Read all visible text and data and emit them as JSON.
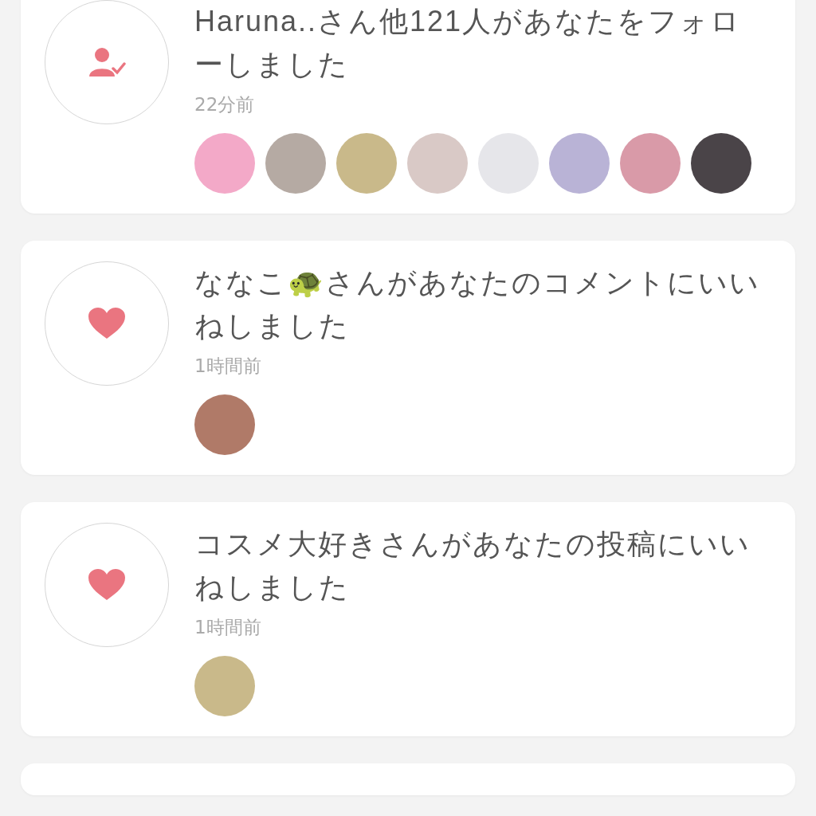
{
  "notifications": [
    {
      "kind": "follow",
      "text": "Haruna..さん他121人があなたをフォローしました",
      "time": "22分前",
      "avatars": [
        {
          "color": "#f3a9c8"
        },
        {
          "color": "#b5aaa3"
        },
        {
          "color": "#c9b98a"
        },
        {
          "color": "#d9c9c6"
        },
        {
          "color": "#e6e6ea"
        },
        {
          "color": "#b9b3d6"
        },
        {
          "color": "#d99aa8"
        },
        {
          "color": "#4a4448"
        }
      ]
    },
    {
      "kind": "like",
      "text": "ななこ🐢さんがあなたのコメントにいいねしました",
      "time": "1時間前",
      "avatars": [
        {
          "color": "#b07a68"
        }
      ]
    },
    {
      "kind": "like",
      "text": "コスメ大好きさんがあなたの投稿にいいねしました",
      "time": "1時間前",
      "avatars": [
        {
          "color": "#c9b98a"
        }
      ]
    }
  ]
}
